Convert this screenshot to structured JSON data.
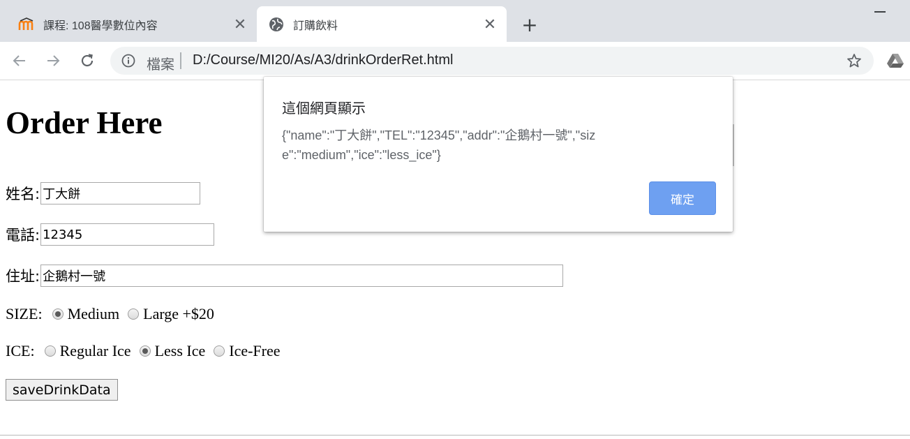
{
  "browser": {
    "tabs": [
      {
        "title": "課程: 108醫學數位內容",
        "icon": "moodle-icon",
        "active": false
      },
      {
        "title": "訂購飲料",
        "icon": "globe-icon",
        "active": true
      }
    ],
    "address_scheme": "檔案",
    "address_url": "D:/Course/MI20/As/A3/drinkOrderRet.html"
  },
  "page": {
    "heading": "Order Here",
    "name_label": "姓名:",
    "name_value": "丁大餅",
    "tel_label": "電話:",
    "tel_value": "12345",
    "addr_label": "住址:",
    "addr_value": "企鵝村一號",
    "size_label": "SIZE:",
    "size_options": [
      {
        "label": "Medium",
        "checked": true
      },
      {
        "label": "Large +$20",
        "checked": false
      }
    ],
    "ice_label": "ICE:",
    "ice_options": [
      {
        "label": "Regular Ice",
        "checked": false
      },
      {
        "label": "Less Ice",
        "checked": true
      },
      {
        "label": "Ice-Free",
        "checked": false
      }
    ],
    "save_button": "saveDrinkData"
  },
  "dialog": {
    "title": "這個網頁顯示",
    "message": "{\"name\":\"丁大餅\",\"TEL\":\"12345\",\"addr\":\"企鵝村一號\",\"size\":\"medium\",\"ice\":\"less_ice\"}",
    "ok_label": "確定",
    "ok_color": "#6ea0f1"
  }
}
